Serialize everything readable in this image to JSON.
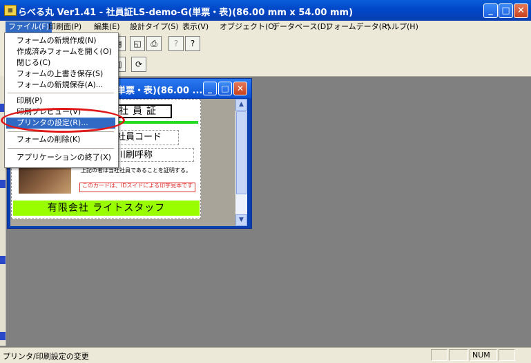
{
  "window": {
    "title": "らべる丸 Ver1.41 - 社員証LS-demo-G(単票・表)(86.00 mm x 54.00 mm)"
  },
  "menubar": [
    "ファイル(F)",
    "印刷面(P)",
    "編集(E)",
    "設計タイプ(S)",
    "表示(V)",
    "オブジェクト(O)",
    "データベース(D)",
    "フォームデータ(R)",
    "ヘルプ(H)"
  ],
  "file_menu": {
    "items": [
      "フォームの新規作成(N)",
      "作成済みフォームを開く(O)",
      "閉じる(C)",
      "フォームの上書き保存(S)",
      "フォームの新規保存(A)...",
      "印刷(P)",
      "印刷プレビュー(V)",
      "プリンタの設定(R)...",
      "フォームの削除(K)",
      "アプリケーションの終了(X)"
    ],
    "selected": "プリンタの設定(R)..."
  },
  "child_window": {
    "title": "単票・表)(86.00 ..."
  },
  "card": {
    "title": "社員証",
    "employee_code": "社員コード",
    "name_field": "川刷呼称",
    "note": "上記の者は当社社員であることを証明する。",
    "warning": "このカードは、IDスイドによる印字見本です",
    "company": "有限会社 ライトスタッフ"
  },
  "statusbar": {
    "message": "プリンタ/印刷設定の変更",
    "num": "NUM"
  }
}
